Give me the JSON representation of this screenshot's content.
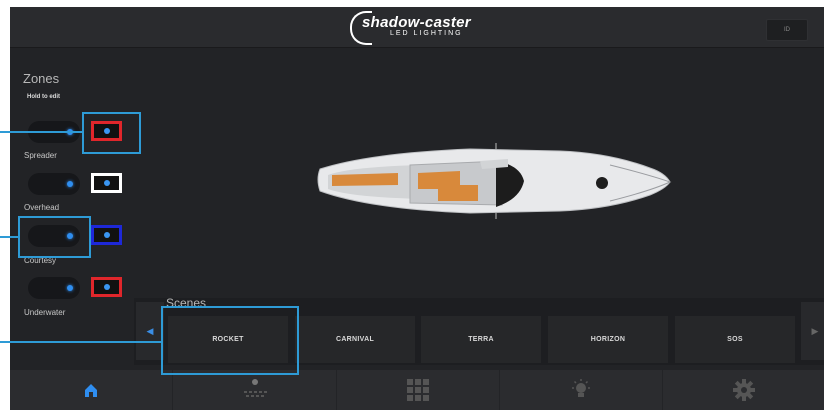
{
  "header": {
    "logo_main": "shadow-caster",
    "logo_sub": "LED LIGHTING",
    "corner_button": "ID"
  },
  "zones": {
    "title": "Zones",
    "hint": "Hold to edit",
    "items": [
      {
        "label": "",
        "color": "#e0262b"
      },
      {
        "label": "Spreader",
        "color": "#ffffff"
      },
      {
        "label": "Overhead",
        "color": "#1e28d8"
      },
      {
        "label": "Courtesy",
        "color": "#e0262b"
      },
      {
        "label": "Underwater"
      }
    ]
  },
  "scenes": {
    "title": "Scenes",
    "items": [
      "ROCKET",
      "CARNIVAL",
      "TERRA",
      "HORIZON",
      "SOS"
    ]
  },
  "nav": {
    "items": [
      "home-icon",
      "lights-icon",
      "grid-icon",
      "bulb-icon",
      "settings-icon"
    ],
    "active_color": "#2f8ef0"
  },
  "callout_color": "#2e9bd6"
}
